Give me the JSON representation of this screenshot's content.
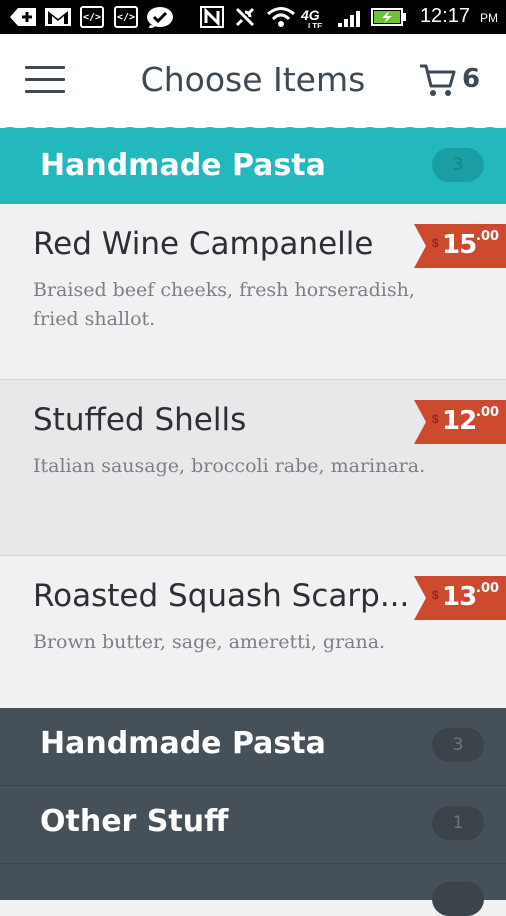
{
  "status_bar": {
    "time": "12:17",
    "ampm": "PM",
    "network": "4G LTE",
    "icons": [
      "add-icon",
      "gmail-icon",
      "code-icon",
      "code-icon",
      "chat-check-icon",
      "nfc-icon",
      "mute-icon",
      "wifi-icon",
      "network-4g-icon",
      "signal-icon",
      "battery-charging-icon"
    ]
  },
  "header": {
    "title": "Choose Items",
    "cart_count": "6"
  },
  "colors": {
    "teal": "#23b8bd",
    "dark": "#465058",
    "price_tag": "#cc4b2f",
    "text_dark": "#3d4a55"
  },
  "active_section": {
    "label": "Handmade Pasta",
    "count": "3"
  },
  "items": [
    {
      "name": "Red Wine Campanelle",
      "description": "Braised beef cheeks, fresh horseradish, fried shallot.",
      "price_dollar": "$",
      "price_main": "15",
      "price_cents": ".00"
    },
    {
      "name": "Stuffed Shells",
      "description": "Italian sausage, broccoli rabe, marinara.",
      "price_dollar": "$",
      "price_main": "12",
      "price_cents": ".00"
    },
    {
      "name": "Roasted Squash Scarp...",
      "description": "Brown butter, sage, ameretti, grana.",
      "price_dollar": "$",
      "price_main": "13",
      "price_cents": ".00"
    }
  ],
  "sections": [
    {
      "label": "Handmade Pasta",
      "count": "3"
    },
    {
      "label": "Other Stuff",
      "count": "1"
    }
  ]
}
